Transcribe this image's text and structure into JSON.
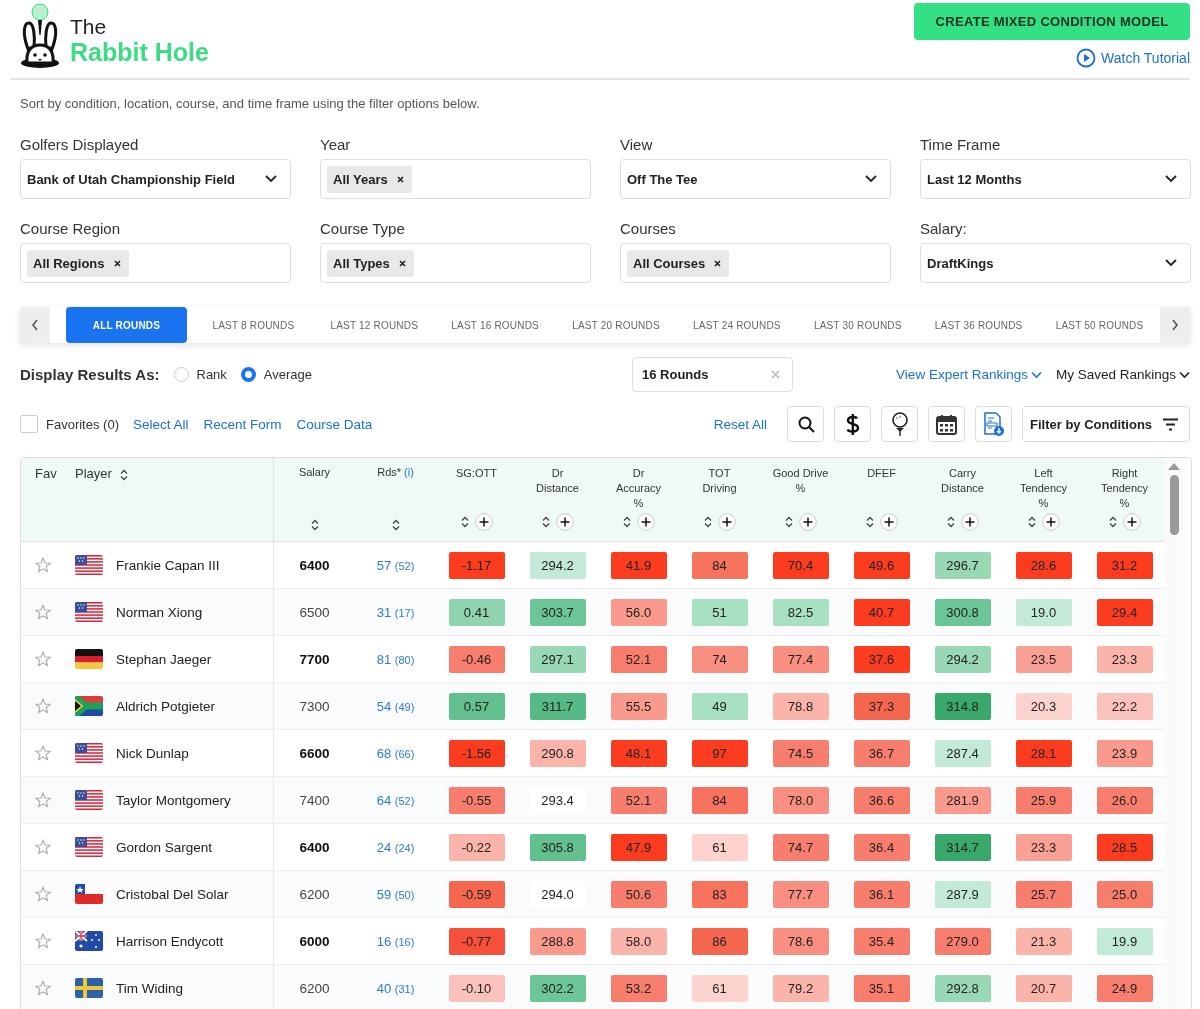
{
  "logo": {
    "line1": "The",
    "line2": "Rabbit Hole"
  },
  "primary_button": "CREATE MIXED CONDITION MODEL",
  "tutorial_link": "Watch Tutorial",
  "intro": "Sort by condition, location, course, and time frame using the filter options below.",
  "filters": [
    {
      "label": "Golfers Displayed",
      "kind": "select",
      "value": "Bank of Utah Championship Field"
    },
    {
      "label": "Year",
      "kind": "tags",
      "tags": [
        "All Years"
      ]
    },
    {
      "label": "View",
      "kind": "select",
      "value": "Off The Tee"
    },
    {
      "label": "Time Frame",
      "kind": "select",
      "value": "Last 12 Months"
    },
    {
      "label": "Course Region",
      "kind": "tags",
      "tags": [
        "All Regions"
      ]
    },
    {
      "label": "Course Type",
      "kind": "tags",
      "tags": [
        "All Types"
      ]
    },
    {
      "label": "Courses",
      "kind": "tags",
      "tags": [
        "All Courses"
      ]
    },
    {
      "label": "Salary:",
      "kind": "select",
      "value": "DraftKings"
    }
  ],
  "round_tabs": [
    {
      "label": "ALL ROUNDS",
      "selected": true
    },
    {
      "label": "LAST 8 ROUNDS",
      "selected": false
    },
    {
      "label": "LAST 12 ROUNDS",
      "selected": false
    },
    {
      "label": "LAST 16 ROUNDS",
      "selected": false
    },
    {
      "label": "LAST 20 ROUNDS",
      "selected": false
    },
    {
      "label": "LAST 24 ROUNDS",
      "selected": false
    },
    {
      "label": "LAST 30 ROUNDS",
      "selected": false
    },
    {
      "label": "LAST 36 ROUNDS",
      "selected": false
    },
    {
      "label": "LAST 50 ROUNDS",
      "selected": false
    }
  ],
  "display_results": {
    "label": "Display Results As:",
    "options": [
      {
        "label": "Rank",
        "selected": false
      },
      {
        "label": "Average",
        "selected": true
      }
    ]
  },
  "rounds_field": {
    "value": "16 Rounds"
  },
  "rankings_links": [
    {
      "label": "View Expert Rankings",
      "kind": "link"
    },
    {
      "label": "My Saved Rankings",
      "kind": "plain"
    }
  ],
  "favorites": {
    "label": "Favorites (0)",
    "checked": false
  },
  "quick_links": [
    "Select All",
    "Recent Form",
    "Course Data"
  ],
  "reset_link": "Reset All",
  "filter_button": "Filter by Conditions",
  "table": {
    "columns": [
      {
        "kind": "fav",
        "label": "Fav"
      },
      {
        "kind": "player",
        "label": "Player"
      },
      {
        "kind": "salary",
        "label": "Salary"
      },
      {
        "kind": "rds",
        "label": "Rds*",
        "info": "(i)"
      }
    ],
    "stat_columns": [
      {
        "label": "SG:OTT"
      },
      {
        "label": "Dr\nDistance"
      },
      {
        "label": "Dr\nAccuracy\n%"
      },
      {
        "label": "TOT\nDriving"
      },
      {
        "label": "Good Drive\n%"
      },
      {
        "label": "DFEF"
      },
      {
        "label": "Carry\nDistance"
      },
      {
        "label": "Left\nTendency\n%"
      },
      {
        "label": "Right\nTendency\n%"
      }
    ],
    "rows": [
      {
        "player": "Frankie Capan III",
        "flag": {
          "kind": "us"
        },
        "favorite": false,
        "salary": "6400",
        "salary_bold": true,
        "rounds": "57",
        "rounds_sub": "(52)",
        "stats": [
          {
            "value": "-1.17",
            "color": "#fb3c1e"
          },
          {
            "value": "294.2",
            "color": "#c2ead6"
          },
          {
            "value": "41.9",
            "color": "#fb3c1e"
          },
          {
            "value": "84",
            "color": "#f7735e"
          },
          {
            "value": "70.4",
            "color": "#fb3c1e"
          },
          {
            "value": "49.6",
            "color": "#fb3c1e"
          },
          {
            "value": "296.7",
            "color": "#98d8b5"
          },
          {
            "value": "28.6",
            "color": "#fb3c1e"
          },
          {
            "value": "31.2",
            "color": "#fb3c1e"
          }
        ]
      },
      {
        "player": "Norman Xiong",
        "flag": {
          "kind": "us"
        },
        "favorite": false,
        "salary": "6500",
        "salary_bold": false,
        "rounds": "31",
        "rounds_sub": "(17)",
        "stats": [
          {
            "value": "0.41",
            "color": "#8fd4ae"
          },
          {
            "value": "303.7",
            "color": "#6cc595"
          },
          {
            "value": "56.0",
            "color": "#f99a8c"
          },
          {
            "value": "51",
            "color": "#a8e0c2"
          },
          {
            "value": "82.5",
            "color": "#a8e0c2"
          },
          {
            "value": "40.7",
            "color": "#fb3c1e"
          },
          {
            "value": "300.8",
            "color": "#6cc595"
          },
          {
            "value": "19.0",
            "color": "#c2ead6"
          },
          {
            "value": "29.4",
            "color": "#fb3c1e"
          }
        ]
      },
      {
        "player": "Stephan Jaeger",
        "flag": {
          "kind": "de"
        },
        "favorite": false,
        "salary": "7700",
        "salary_bold": true,
        "rounds": "81",
        "rounds_sub": "(80)",
        "stats": [
          {
            "value": "-0.46",
            "color": "#f77e6c"
          },
          {
            "value": "297.1",
            "color": "#98d8b5"
          },
          {
            "value": "52.1",
            "color": "#f77e6c"
          },
          {
            "value": "74",
            "color": "#f98f80"
          },
          {
            "value": "77.4",
            "color": "#f98f80"
          },
          {
            "value": "37.6",
            "color": "#fb3c1e"
          },
          {
            "value": "294.2",
            "color": "#98d8b5"
          },
          {
            "value": "23.5",
            "color": "#f9a194"
          },
          {
            "value": "23.3",
            "color": "#fbb4aa"
          }
        ]
      },
      {
        "player": "Aldrich Potgieter",
        "flag": {
          "kind": "za"
        },
        "favorite": false,
        "salary": "7300",
        "salary_bold": false,
        "rounds": "54",
        "rounds_sub": "(49)",
        "stats": [
          {
            "value": "0.57",
            "color": "#62c08e"
          },
          {
            "value": "311.7",
            "color": "#55ba84"
          },
          {
            "value": "55.5",
            "color": "#f99a8c"
          },
          {
            "value": "49",
            "color": "#a8e0c2"
          },
          {
            "value": "78.8",
            "color": "#fbb4aa"
          },
          {
            "value": "37.3",
            "color": "#f5664f"
          },
          {
            "value": "314.8",
            "color": "#38a96a"
          },
          {
            "value": "20.3",
            "color": "#fcd3cd"
          },
          {
            "value": "22.2",
            "color": "#fbc2bb"
          }
        ]
      },
      {
        "player": "Nick Dunlap",
        "flag": {
          "kind": "us"
        },
        "favorite": false,
        "salary": "6600",
        "salary_bold": true,
        "rounds": "68",
        "rounds_sub": "(66)",
        "stats": [
          {
            "value": "-1.56",
            "color": "#fb3c1e"
          },
          {
            "value": "290.8",
            "color": "#fbb4aa"
          },
          {
            "value": "48.1",
            "color": "#fb3c1e"
          },
          {
            "value": "97",
            "color": "#fb3c1e"
          },
          {
            "value": "74.5",
            "color": "#f77e6c"
          },
          {
            "value": "36.7",
            "color": "#f77e6c"
          },
          {
            "value": "287.4",
            "color": "#c2ead6"
          },
          {
            "value": "28.1",
            "color": "#fb3c1e"
          },
          {
            "value": "23.9",
            "color": "#f99a8c"
          }
        ]
      },
      {
        "player": "Taylor Montgomery",
        "flag": {
          "kind": "us"
        },
        "favorite": false,
        "salary": "7400",
        "salary_bold": false,
        "rounds": "64",
        "rounds_sub": "(52)",
        "stats": [
          {
            "value": "-0.55",
            "color": "#f77e6c"
          },
          {
            "value": "293.4",
            "color": "#ffffff"
          },
          {
            "value": "52.1",
            "color": "#f77e6c"
          },
          {
            "value": "84",
            "color": "#f7735e"
          },
          {
            "value": "78.0",
            "color": "#f98f80"
          },
          {
            "value": "36.6",
            "color": "#f77e6c"
          },
          {
            "value": "281.9",
            "color": "#f99a8c"
          },
          {
            "value": "25.9",
            "color": "#f77e6c"
          },
          {
            "value": "26.0",
            "color": "#f77e6c"
          }
        ]
      },
      {
        "player": "Gordon Sargent",
        "flag": {
          "kind": "us"
        },
        "favorite": false,
        "salary": "6400",
        "salary_bold": true,
        "rounds": "24",
        "rounds_sub": "(24)",
        "stats": [
          {
            "value": "-0.22",
            "color": "#fbb4aa"
          },
          {
            "value": "305.8",
            "color": "#62c08e"
          },
          {
            "value": "47.9",
            "color": "#fb3c1e"
          },
          {
            "value": "61",
            "color": "#fcd3cd"
          },
          {
            "value": "74.7",
            "color": "#f77e6c"
          },
          {
            "value": "36.4",
            "color": "#f77e6c"
          },
          {
            "value": "314.7",
            "color": "#38a96a"
          },
          {
            "value": "23.3",
            "color": "#f9a194"
          },
          {
            "value": "28.5",
            "color": "#fb3c1e"
          }
        ]
      },
      {
        "player": "Cristobal Del Solar",
        "flag": {
          "kind": "cl"
        },
        "favorite": false,
        "salary": "6200",
        "salary_bold": false,
        "rounds": "59",
        "rounds_sub": "(50)",
        "stats": [
          {
            "value": "-0.59",
            "color": "#f5664f"
          },
          {
            "value": "294.0",
            "color": "#ffffff"
          },
          {
            "value": "50.6",
            "color": "#f77e6c"
          },
          {
            "value": "83",
            "color": "#f7735e"
          },
          {
            "value": "77.7",
            "color": "#f98f80"
          },
          {
            "value": "36.1",
            "color": "#f77e6c"
          },
          {
            "value": "287.9",
            "color": "#c2ead6"
          },
          {
            "value": "25.7",
            "color": "#f77e6c"
          },
          {
            "value": "25.0",
            "color": "#f77e6c"
          }
        ]
      },
      {
        "player": "Harrison Endycott",
        "flag": {
          "kind": "au"
        },
        "favorite": false,
        "salary": "6000",
        "salary_bold": true,
        "rounds": "16",
        "rounds_sub": "(16)",
        "stats": [
          {
            "value": "-0.77",
            "color": "#f6503a"
          },
          {
            "value": "288.8",
            "color": "#f99a8c"
          },
          {
            "value": "58.0",
            "color": "#fbb4aa"
          },
          {
            "value": "86",
            "color": "#f5664f"
          },
          {
            "value": "78.6",
            "color": "#f98f80"
          },
          {
            "value": "35.4",
            "color": "#f77e6c"
          },
          {
            "value": "279.0",
            "color": "#f77e6c"
          },
          {
            "value": "21.3",
            "color": "#fbb4aa"
          },
          {
            "value": "19.9",
            "color": "#c2ead6"
          }
        ]
      },
      {
        "player": "Tim Widing",
        "flag": {
          "kind": "se"
        },
        "favorite": false,
        "salary": "6200",
        "salary_bold": false,
        "rounds": "40",
        "rounds_sub": "(31)",
        "stats": [
          {
            "value": "-0.10",
            "color": "#fbc2bb"
          },
          {
            "value": "302.2",
            "color": "#6cc595"
          },
          {
            "value": "53.2",
            "color": "#f77e6c"
          },
          {
            "value": "61",
            "color": "#fcd3cd"
          },
          {
            "value": "79.2",
            "color": "#fbb4aa"
          },
          {
            "value": "35.1",
            "color": "#f77e6c"
          },
          {
            "value": "292.8",
            "color": "#98d8b5"
          },
          {
            "value": "20.7",
            "color": "#fbb4aa"
          },
          {
            "value": "24.9",
            "color": "#f77e6c"
          }
        ]
      }
    ]
  }
}
